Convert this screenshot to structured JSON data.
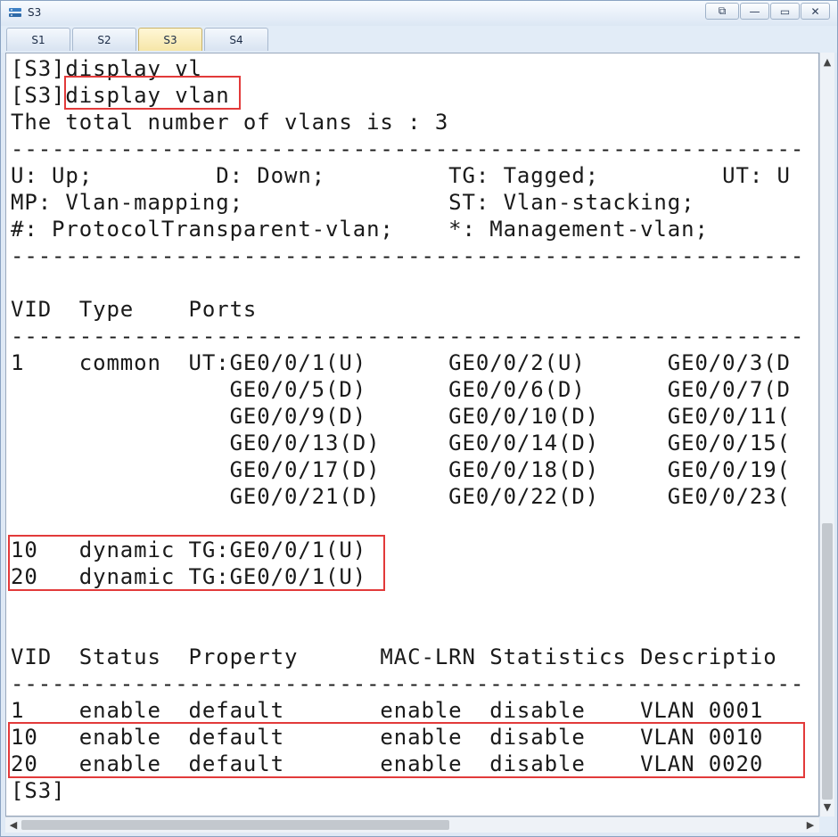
{
  "window": {
    "title": "S3",
    "icon": "network-device-icon",
    "controls": {
      "restore": "⧉",
      "minimize": "—",
      "maximize": "▭",
      "close": "✕"
    }
  },
  "tabs": [
    {
      "label": "S1",
      "active": false
    },
    {
      "label": "S2",
      "active": false
    },
    {
      "label": "S3",
      "active": true
    },
    {
      "label": "S4",
      "active": false
    }
  ],
  "terminal": {
    "lines": [
      "[S3]display vl",
      "[S3]display vlan",
      "The total number of vlans is : 3",
      "----------------------------------------------------------",
      "U: Up;         D: Down;         TG: Tagged;         UT: U",
      "MP: Vlan-mapping;               ST: Vlan-stacking;",
      "#: ProtocolTransparent-vlan;    *: Management-vlan;",
      "----------------------------------------------------------",
      "",
      "VID  Type    Ports",
      "----------------------------------------------------------",
      "1    common  UT:GE0/0/1(U)      GE0/0/2(U)      GE0/0/3(D",
      "                GE0/0/5(D)      GE0/0/6(D)      GE0/0/7(D",
      "                GE0/0/9(D)      GE0/0/10(D)     GE0/0/11(",
      "                GE0/0/13(D)     GE0/0/14(D)     GE0/0/15(",
      "                GE0/0/17(D)     GE0/0/18(D)     GE0/0/19(",
      "                GE0/0/21(D)     GE0/0/22(D)     GE0/0/23(",
      "",
      "10   dynamic TG:GE0/0/1(U)",
      "20   dynamic TG:GE0/0/1(U)",
      "",
      "",
      "VID  Status  Property      MAC-LRN Statistics Descriptio",
      "----------------------------------------------------------",
      "1    enable  default       enable  disable    VLAN 0001",
      "10   enable  default       enable  disable    VLAN 0010",
      "20   enable  default       enable  disable    VLAN 0020",
      "[S3]"
    ]
  },
  "colors": {
    "highlight_border": "#e23a3a",
    "terminal_text": "#1a1a1a",
    "window_chrome": "#dfe9f5",
    "active_tab": "#f6e6a8"
  },
  "scrollbars": {
    "up_arrow": "▲",
    "down_arrow": "▼",
    "left_arrow": "◀",
    "right_arrow": "▶"
  }
}
